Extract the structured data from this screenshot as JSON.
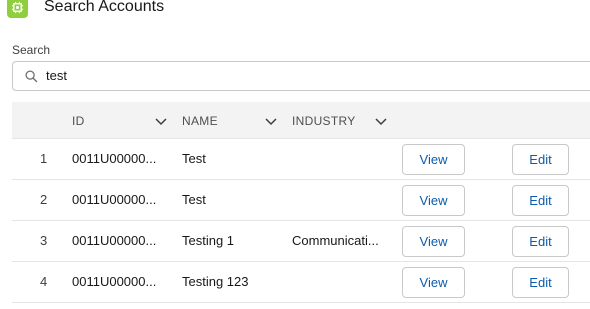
{
  "header": {
    "title": "Search Accounts",
    "icon": "account-chip-icon",
    "icon_color": "#8fcf3f"
  },
  "search": {
    "label": "Search",
    "value": "test"
  },
  "table": {
    "columns": [
      "ID",
      "NAME",
      "INDUSTRY"
    ],
    "rows": [
      {
        "num": "1",
        "id": "0011U00000...",
        "name": "Test",
        "industry": "",
        "view": "View",
        "edit": "Edit"
      },
      {
        "num": "2",
        "id": "0011U00000...",
        "name": "Test",
        "industry": "",
        "view": "View",
        "edit": "Edit"
      },
      {
        "num": "3",
        "id": "0011U00000...",
        "name": "Testing 1",
        "industry": "Communicati...",
        "view": "View",
        "edit": "Edit"
      },
      {
        "num": "4",
        "id": "0011U00000...",
        "name": "Testing 123",
        "industry": "",
        "view": "View",
        "edit": "Edit"
      }
    ]
  }
}
